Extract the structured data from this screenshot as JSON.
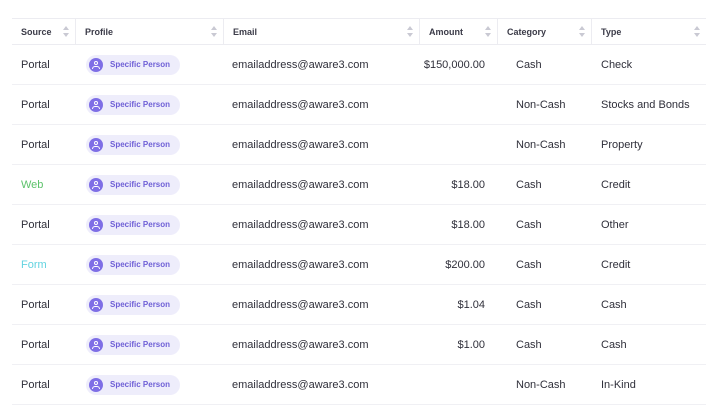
{
  "columns": [
    {
      "key": "source",
      "label": "Source"
    },
    {
      "key": "profile",
      "label": "Profile"
    },
    {
      "key": "email",
      "label": "Email"
    },
    {
      "key": "amount",
      "label": "Amount"
    },
    {
      "key": "category",
      "label": "Category"
    },
    {
      "key": "type",
      "label": "Type"
    }
  ],
  "rows": [
    {
      "source": "Portal",
      "profile": "Specific Person",
      "email": "emailaddress@aware3.com",
      "amount": "$150,000.00",
      "category": "Cash",
      "type": "Check"
    },
    {
      "source": "Portal",
      "profile": "Specific Person",
      "email": "emailaddress@aware3.com",
      "amount": "",
      "category": "Non-Cash",
      "type": "Stocks and Bonds"
    },
    {
      "source": "Portal",
      "profile": "Specific Person",
      "email": "emailaddress@aware3.com",
      "amount": "",
      "category": "Non-Cash",
      "type": "Property"
    },
    {
      "source": "Web",
      "profile": "Specific Person",
      "email": "emailaddress@aware3.com",
      "amount": "$18.00",
      "category": "Cash",
      "type": "Credit"
    },
    {
      "source": "Portal",
      "profile": "Specific Person",
      "email": "emailaddress@aware3.com",
      "amount": "$18.00",
      "category": "Cash",
      "type": "Other"
    },
    {
      "source": "Form",
      "profile": "Specific Person",
      "email": "emailaddress@aware3.com",
      "amount": "$200.00",
      "category": "Cash",
      "type": "Credit"
    },
    {
      "source": "Portal",
      "profile": "Specific Person",
      "email": "emailaddress@aware3.com",
      "amount": "$1.04",
      "category": "Cash",
      "type": "Cash"
    },
    {
      "source": "Portal",
      "profile": "Specific Person",
      "email": "emailaddress@aware3.com",
      "amount": "$1.00",
      "category": "Cash",
      "type": "Cash"
    },
    {
      "source": "Portal",
      "profile": "Specific Person",
      "email": "emailaddress@aware3.com",
      "amount": "",
      "category": "Non-Cash",
      "type": "In-Kind"
    }
  ],
  "icons": {
    "sort": "sort-arrows-icon",
    "avatar": "person-icon"
  },
  "colors": {
    "web": "#5cc26a",
    "form": "#62d3e0",
    "pill_bg": "#eeedfb",
    "pill_text": "#6e5fd6",
    "avatar": "#7e6ee6"
  }
}
